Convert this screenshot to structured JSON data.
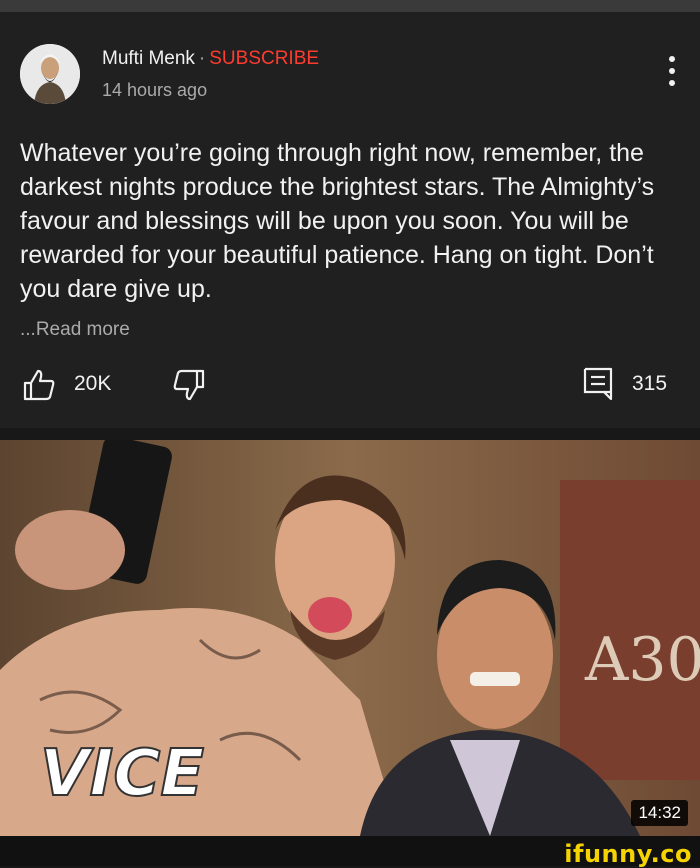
{
  "post": {
    "channel_name": "Mufti Menk",
    "separator": "·",
    "subscribe_label": "SUBSCRIBE",
    "time_ago": "14 hours ago",
    "text": "Whatever you’re going through right now, remember, the darkest nights produce the brightest stars. The Almighty’s favour and blessings will be upon you soon. You will be rewarded for your beautiful patience. Hang on tight. Don’t you dare give up.",
    "read_more_label": "...Read more",
    "like_count": "20K",
    "comment_count": "315",
    "icons": {
      "more": "more-vert-icon",
      "like": "thumbs-up-icon",
      "dislike": "thumbs-down-icon",
      "comment": "comment-icon"
    }
  },
  "thumbnail": {
    "logo_text": "VICE",
    "duration": "14:32"
  },
  "watermark": {
    "text": "ifunny.co"
  },
  "colors": {
    "background": "#202020",
    "subscribe": "#ff3b30",
    "text": "#f1f1f1",
    "secondary_text": "#aaaaaa",
    "watermark": "#f5d300"
  }
}
